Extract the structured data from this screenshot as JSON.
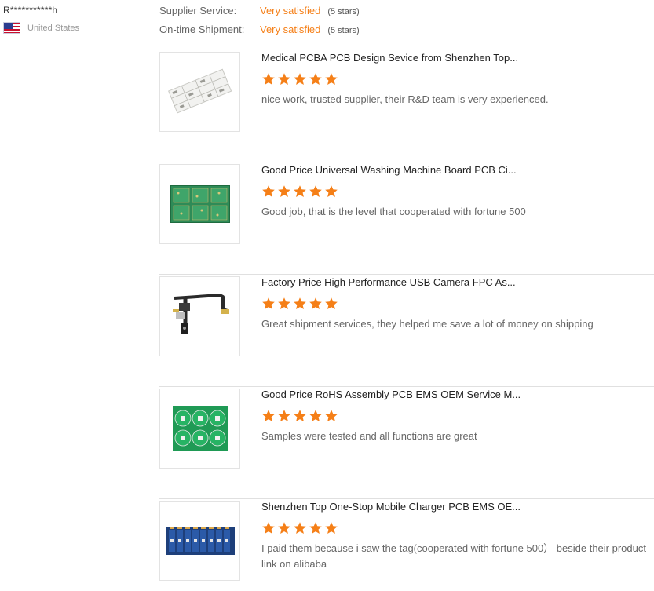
{
  "reviewer": {
    "name": "R***********h",
    "country": "United States",
    "flag_icon": "us-flag-icon"
  },
  "ratings": [
    {
      "label": "Supplier Service:",
      "value": "Very satisfied",
      "stars_text": "(5 stars)"
    },
    {
      "label": "On-time Shipment:",
      "value": "Very satisfied",
      "stars_text": "(5 stars)"
    }
  ],
  "colors": {
    "accent": "#f57f17",
    "star": "#f57f17"
  },
  "reviews": [
    {
      "title": "Medical PCBA PCB Design Sevice from Shenzhen Top...",
      "stars": 5,
      "comment": "nice work, trusted supplier, their R&D team is very experienced.",
      "image_icon": "white-pcb-image"
    },
    {
      "title": "Good Price Universal Washing Machine Board PCB Ci...",
      "stars": 5,
      "comment": "Good job, that is the level that cooperated with fortune 500",
      "image_icon": "green-pcb-panel-image"
    },
    {
      "title": "Factory Price High Performance USB Camera FPC As...",
      "stars": 5,
      "comment": "Great shipment services, they helped me save a lot of money on shipping",
      "image_icon": "flex-cable-image"
    },
    {
      "title": "Good Price RoHS Assembly PCB EMS OEM Service M...",
      "stars": 5,
      "comment": "Samples were tested and all functions are great",
      "image_icon": "round-pcb-panel-image"
    },
    {
      "title": "Shenzhen Top One-Stop Mobile Charger PCB EMS OE...",
      "stars": 5,
      "comment": "I paid them because i saw the tag(cooperated with fortune 500） beside their product link on alibaba",
      "image_icon": "blue-pcb-strip-image"
    }
  ]
}
